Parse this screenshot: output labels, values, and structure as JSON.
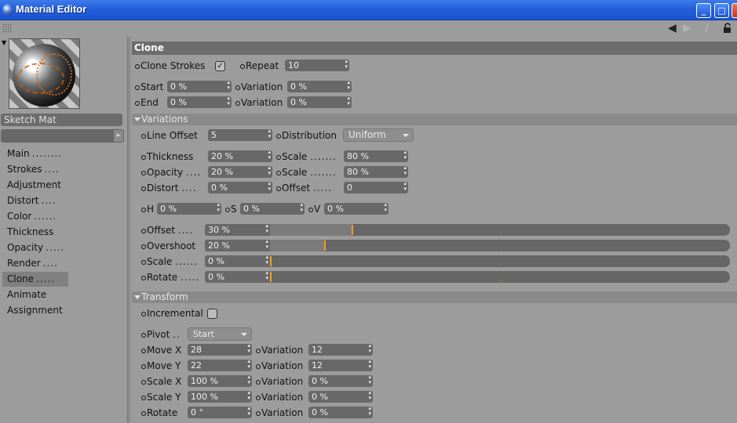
{
  "window": {
    "title": "Material Editor",
    "min": "_",
    "max": "□",
    "close": "×"
  },
  "toolbar": {
    "back": "◀",
    "forward": "▶",
    "pin": "/",
    "lock": "🔓"
  },
  "material": {
    "name": "Sketch Mat",
    "menu_arrow": "▸"
  },
  "nav": [
    "Main",
    "Strokes",
    "Adjustment",
    "Distort",
    "Color",
    "Thickness",
    "Opacity",
    "Render",
    "Clone",
    "Animate",
    "Assignment"
  ],
  "nav_dots": [
    "........",
    "....",
    "",
    "....",
    "......",
    "",
    ".....",
    "....",
    ".....",
    "",
    ""
  ],
  "selected_nav": "Clone",
  "clone": {
    "header": "Clone",
    "clone_strokes_label": "Clone Strokes",
    "clone_strokes_checked": "✓",
    "repeat_label": "Repeat",
    "repeat_value": "10",
    "start_label": "Start",
    "start_value": "0 %",
    "start_variation_label": "Variation",
    "start_variation_value": "0 %",
    "end_label": "End",
    "end_value": "0 %",
    "end_variation_label": "Variation",
    "end_variation_value": "0 %"
  },
  "variations": {
    "header": "Variations",
    "line_offset_label": "Line Offset",
    "line_offset_value": "5",
    "distribution_label": "Distribution",
    "distribution_value": "Uniform",
    "thickness_label": "Thickness",
    "thickness_value": "20 %",
    "thickness_scale_label": "Scale",
    "thickness_scale_dots": ".......",
    "thickness_scale_value": "80 %",
    "opacity_label": "Opacity",
    "opacity_dots": "....",
    "opacity_value": "20 %",
    "opacity_scale_label": "Scale",
    "opacity_scale_dots": ".......",
    "opacity_scale_value": "80 %",
    "distort_label": "Distort",
    "distort_dots": "....",
    "distort_value": "0 %",
    "offset_label": "Offset",
    "offset_dots": ".....",
    "offset_value": "0",
    "h_label": "H",
    "h_value": "0 %",
    "s_label": "S",
    "s_value": "0 %",
    "v_label": "V",
    "v_value": "0 %",
    "sliders": [
      {
        "label": "Offset",
        "dots": "....",
        "value": "30 %",
        "fraction": 0.3
      },
      {
        "label": "Overshoot",
        "dots": "",
        "value": "20 %",
        "fraction": 0.2
      },
      {
        "label": "Scale",
        "dots": "......",
        "value": "0 %",
        "fraction": 0
      },
      {
        "label": "Rotate",
        "dots": ".....",
        "value": "0 %",
        "fraction": 0
      }
    ]
  },
  "transform": {
    "header": "Transform",
    "incremental_label": "Incremental",
    "pivot_label": "Pivot",
    "pivot_dots": "..",
    "pivot_value": "Start",
    "rows": [
      {
        "label": "Move X",
        "value": "28",
        "var_label": "Variation",
        "var_value": "12"
      },
      {
        "label": "Move Y",
        "value": "22",
        "var_label": "Variation",
        "var_value": "12"
      },
      {
        "label": "Scale X",
        "value": "100 %",
        "var_label": "Variation",
        "var_value": "0 %"
      },
      {
        "label": "Scale Y",
        "value": "100 %",
        "var_label": "Variation",
        "var_value": "0 %"
      },
      {
        "label": "Rotate",
        "value": "0 °",
        "var_label": "Variation",
        "var_value": "0 %"
      }
    ]
  }
}
